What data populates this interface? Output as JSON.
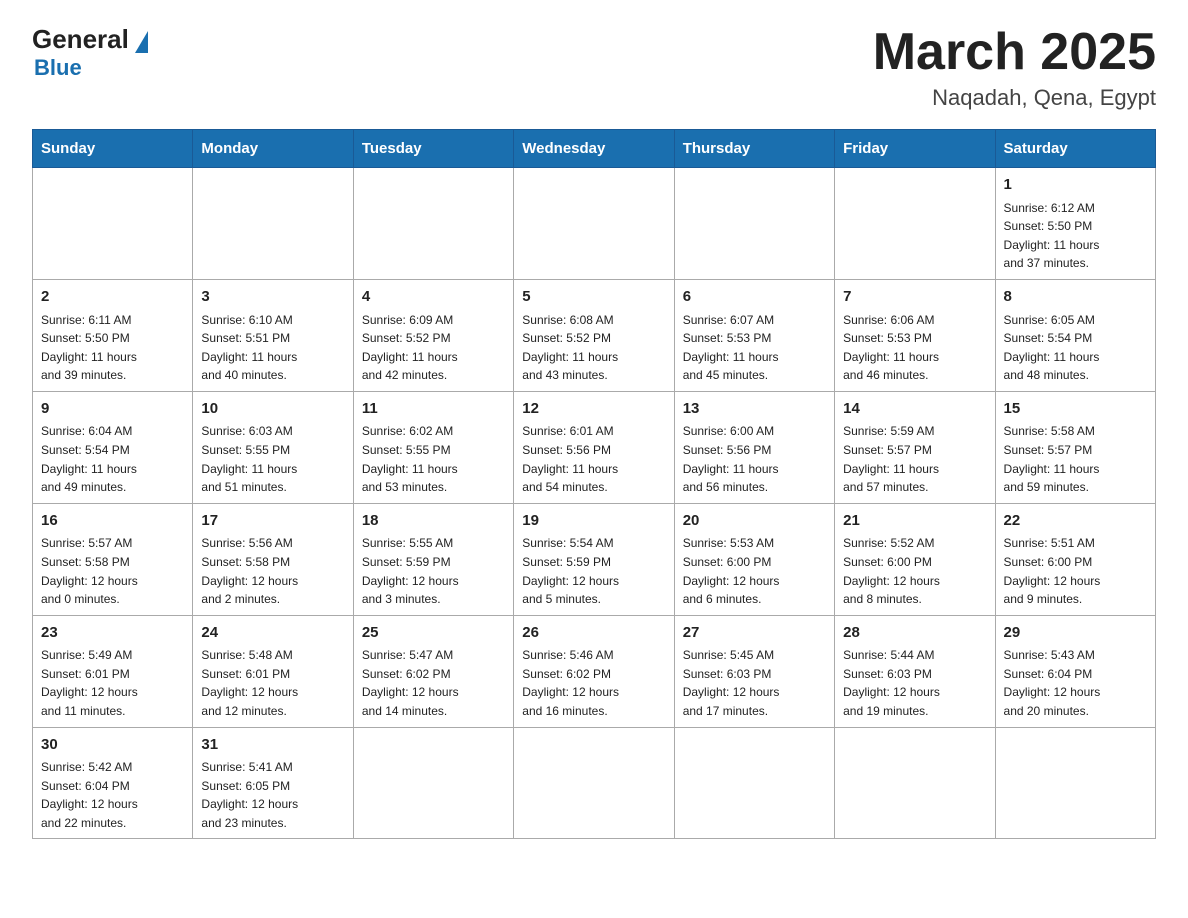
{
  "header": {
    "logo_general": "General",
    "logo_blue": "Blue",
    "title": "March 2025",
    "subtitle": "Naqadah, Qena, Egypt"
  },
  "days_of_week": [
    "Sunday",
    "Monday",
    "Tuesday",
    "Wednesday",
    "Thursday",
    "Friday",
    "Saturday"
  ],
  "weeks": [
    [
      {
        "num": "",
        "info": ""
      },
      {
        "num": "",
        "info": ""
      },
      {
        "num": "",
        "info": ""
      },
      {
        "num": "",
        "info": ""
      },
      {
        "num": "",
        "info": ""
      },
      {
        "num": "",
        "info": ""
      },
      {
        "num": "1",
        "info": "Sunrise: 6:12 AM\nSunset: 5:50 PM\nDaylight: 11 hours\nand 37 minutes."
      }
    ],
    [
      {
        "num": "2",
        "info": "Sunrise: 6:11 AM\nSunset: 5:50 PM\nDaylight: 11 hours\nand 39 minutes."
      },
      {
        "num": "3",
        "info": "Sunrise: 6:10 AM\nSunset: 5:51 PM\nDaylight: 11 hours\nand 40 minutes."
      },
      {
        "num": "4",
        "info": "Sunrise: 6:09 AM\nSunset: 5:52 PM\nDaylight: 11 hours\nand 42 minutes."
      },
      {
        "num": "5",
        "info": "Sunrise: 6:08 AM\nSunset: 5:52 PM\nDaylight: 11 hours\nand 43 minutes."
      },
      {
        "num": "6",
        "info": "Sunrise: 6:07 AM\nSunset: 5:53 PM\nDaylight: 11 hours\nand 45 minutes."
      },
      {
        "num": "7",
        "info": "Sunrise: 6:06 AM\nSunset: 5:53 PM\nDaylight: 11 hours\nand 46 minutes."
      },
      {
        "num": "8",
        "info": "Sunrise: 6:05 AM\nSunset: 5:54 PM\nDaylight: 11 hours\nand 48 minutes."
      }
    ],
    [
      {
        "num": "9",
        "info": "Sunrise: 6:04 AM\nSunset: 5:54 PM\nDaylight: 11 hours\nand 49 minutes."
      },
      {
        "num": "10",
        "info": "Sunrise: 6:03 AM\nSunset: 5:55 PM\nDaylight: 11 hours\nand 51 minutes."
      },
      {
        "num": "11",
        "info": "Sunrise: 6:02 AM\nSunset: 5:55 PM\nDaylight: 11 hours\nand 53 minutes."
      },
      {
        "num": "12",
        "info": "Sunrise: 6:01 AM\nSunset: 5:56 PM\nDaylight: 11 hours\nand 54 minutes."
      },
      {
        "num": "13",
        "info": "Sunrise: 6:00 AM\nSunset: 5:56 PM\nDaylight: 11 hours\nand 56 minutes."
      },
      {
        "num": "14",
        "info": "Sunrise: 5:59 AM\nSunset: 5:57 PM\nDaylight: 11 hours\nand 57 minutes."
      },
      {
        "num": "15",
        "info": "Sunrise: 5:58 AM\nSunset: 5:57 PM\nDaylight: 11 hours\nand 59 minutes."
      }
    ],
    [
      {
        "num": "16",
        "info": "Sunrise: 5:57 AM\nSunset: 5:58 PM\nDaylight: 12 hours\nand 0 minutes."
      },
      {
        "num": "17",
        "info": "Sunrise: 5:56 AM\nSunset: 5:58 PM\nDaylight: 12 hours\nand 2 minutes."
      },
      {
        "num": "18",
        "info": "Sunrise: 5:55 AM\nSunset: 5:59 PM\nDaylight: 12 hours\nand 3 minutes."
      },
      {
        "num": "19",
        "info": "Sunrise: 5:54 AM\nSunset: 5:59 PM\nDaylight: 12 hours\nand 5 minutes."
      },
      {
        "num": "20",
        "info": "Sunrise: 5:53 AM\nSunset: 6:00 PM\nDaylight: 12 hours\nand 6 minutes."
      },
      {
        "num": "21",
        "info": "Sunrise: 5:52 AM\nSunset: 6:00 PM\nDaylight: 12 hours\nand 8 minutes."
      },
      {
        "num": "22",
        "info": "Sunrise: 5:51 AM\nSunset: 6:00 PM\nDaylight: 12 hours\nand 9 minutes."
      }
    ],
    [
      {
        "num": "23",
        "info": "Sunrise: 5:49 AM\nSunset: 6:01 PM\nDaylight: 12 hours\nand 11 minutes."
      },
      {
        "num": "24",
        "info": "Sunrise: 5:48 AM\nSunset: 6:01 PM\nDaylight: 12 hours\nand 12 minutes."
      },
      {
        "num": "25",
        "info": "Sunrise: 5:47 AM\nSunset: 6:02 PM\nDaylight: 12 hours\nand 14 minutes."
      },
      {
        "num": "26",
        "info": "Sunrise: 5:46 AM\nSunset: 6:02 PM\nDaylight: 12 hours\nand 16 minutes."
      },
      {
        "num": "27",
        "info": "Sunrise: 5:45 AM\nSunset: 6:03 PM\nDaylight: 12 hours\nand 17 minutes."
      },
      {
        "num": "28",
        "info": "Sunrise: 5:44 AM\nSunset: 6:03 PM\nDaylight: 12 hours\nand 19 minutes."
      },
      {
        "num": "29",
        "info": "Sunrise: 5:43 AM\nSunset: 6:04 PM\nDaylight: 12 hours\nand 20 minutes."
      }
    ],
    [
      {
        "num": "30",
        "info": "Sunrise: 5:42 AM\nSunset: 6:04 PM\nDaylight: 12 hours\nand 22 minutes."
      },
      {
        "num": "31",
        "info": "Sunrise: 5:41 AM\nSunset: 6:05 PM\nDaylight: 12 hours\nand 23 minutes."
      },
      {
        "num": "",
        "info": ""
      },
      {
        "num": "",
        "info": ""
      },
      {
        "num": "",
        "info": ""
      },
      {
        "num": "",
        "info": ""
      },
      {
        "num": "",
        "info": ""
      }
    ]
  ]
}
